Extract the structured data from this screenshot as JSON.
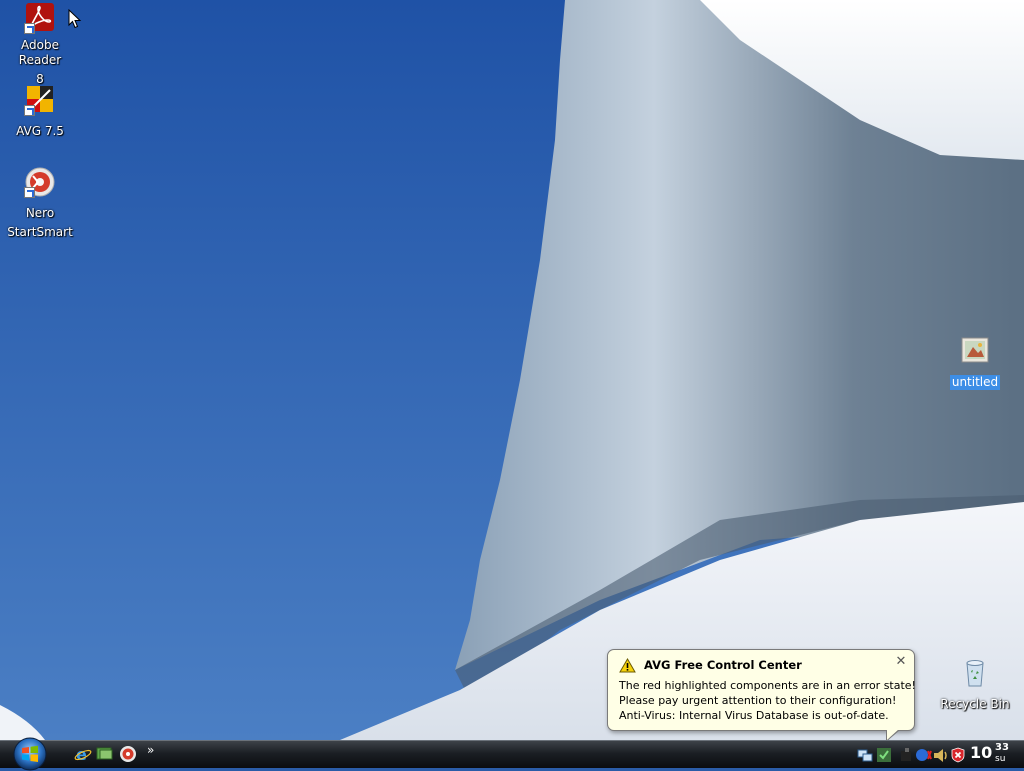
{
  "desktop": {
    "icons": [
      {
        "label_line1": "Adobe Reader",
        "label_line2": "8",
        "icon": "adobe-reader-icon"
      },
      {
        "label_line1": "AVG 7.5",
        "icon": "avg-icon"
      },
      {
        "label_line1": "Nero",
        "label_line2": "StartSmart",
        "icon": "nero-icon"
      },
      {
        "label_line1": "untitled",
        "icon": "image-file-icon",
        "selected": true
      },
      {
        "label_line1": "Recycle Bin",
        "icon": "recycle-bin-icon"
      }
    ]
  },
  "notification": {
    "title": "AVG Free Control Center",
    "line1": "The red highlighted components are in an error state!",
    "line2": "Please pay urgent attention to their configuration!",
    "line3": "Anti-Virus: Internal Virus Database is out-of-date.",
    "close_symbol": "✕",
    "icon": "warning-icon"
  },
  "taskbar": {
    "quick_launch": [
      "internet-explorer-icon",
      "show-desktop-icon",
      "nero-quicklaunch-icon"
    ],
    "more_symbol": "»",
    "tray_icons": [
      "network-icon",
      "security-check-icon",
      "avg-tray-icon",
      "bluetooth-icon",
      "volume-icon",
      "warning-shield-icon"
    ],
    "clock": {
      "hours": "10",
      "minutes": "33",
      "day": "su"
    }
  },
  "colors": {
    "sky": "#2f63b3",
    "selection": "#3d8ee6",
    "balloon_bg": "#ffffe6"
  }
}
